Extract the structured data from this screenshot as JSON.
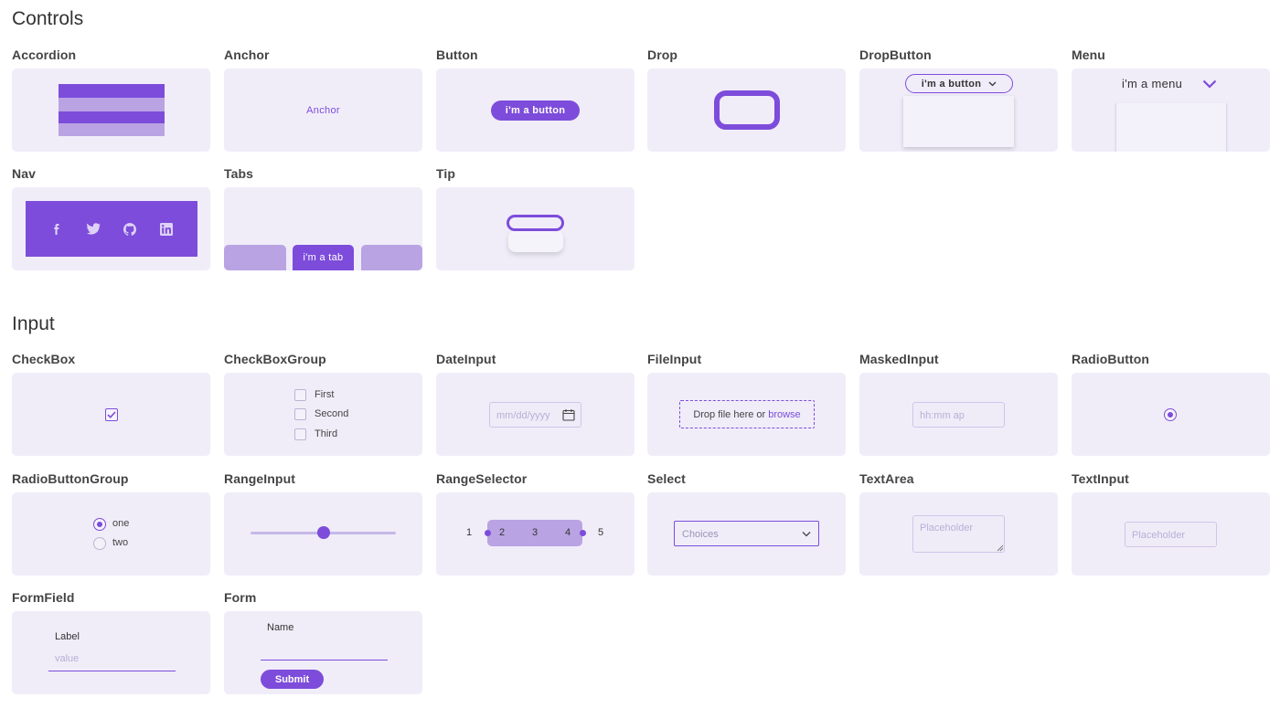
{
  "sections": {
    "controls": "Controls",
    "input": "Input"
  },
  "controls": {
    "accordion": {
      "label": "Accordion"
    },
    "anchor": {
      "label": "Anchor",
      "text": "Anchor"
    },
    "button": {
      "label": "Button",
      "text": "i'm a button"
    },
    "drop": {
      "label": "Drop"
    },
    "dropbutton": {
      "label": "DropButton",
      "text": "i'm a button"
    },
    "menu": {
      "label": "Menu",
      "text": "i'm a menu"
    },
    "nav": {
      "label": "Nav",
      "icons": [
        "facebook-icon",
        "twitter-icon",
        "github-icon",
        "linkedin-icon"
      ]
    },
    "tabs": {
      "label": "Tabs",
      "text": "i'm a tab"
    },
    "tip": {
      "label": "Tip"
    }
  },
  "input": {
    "checkbox": {
      "label": "CheckBox"
    },
    "checkboxgroup": {
      "label": "CheckBoxGroup",
      "options": [
        "First",
        "Second",
        "Third"
      ]
    },
    "dateinput": {
      "label": "DateInput",
      "placeholder": "mm/dd/yyyy"
    },
    "fileinput": {
      "label": "FileInput",
      "text": "Drop file here or",
      "link": "browse"
    },
    "maskedinput": {
      "label": "MaskedInput",
      "placeholder": "hh:mm ap"
    },
    "radiobutton": {
      "label": "RadioButton"
    },
    "radiobuttongroup": {
      "label": "RadioButtonGroup",
      "options": [
        "one",
        "two"
      ]
    },
    "rangeinput": {
      "label": "RangeInput",
      "value_fraction": 0.5
    },
    "rangeselector": {
      "label": "RangeSelector",
      "values": [
        "1",
        "2",
        "3",
        "4",
        "5"
      ]
    },
    "select": {
      "label": "Select",
      "placeholder": "Choices"
    },
    "textarea": {
      "label": "TextArea",
      "placeholder": "Placeholder"
    },
    "textinput": {
      "label": "TextInput",
      "placeholder": "Placeholder"
    },
    "formfield": {
      "label": "FormField",
      "field_label": "Label",
      "value": "value"
    },
    "form": {
      "label": "Form",
      "field_label": "Name",
      "submit": "Submit"
    }
  },
  "colors": {
    "accent": "#7d4cdb",
    "accent_light": "#b9a3e3",
    "tile": "#f0edf9"
  }
}
